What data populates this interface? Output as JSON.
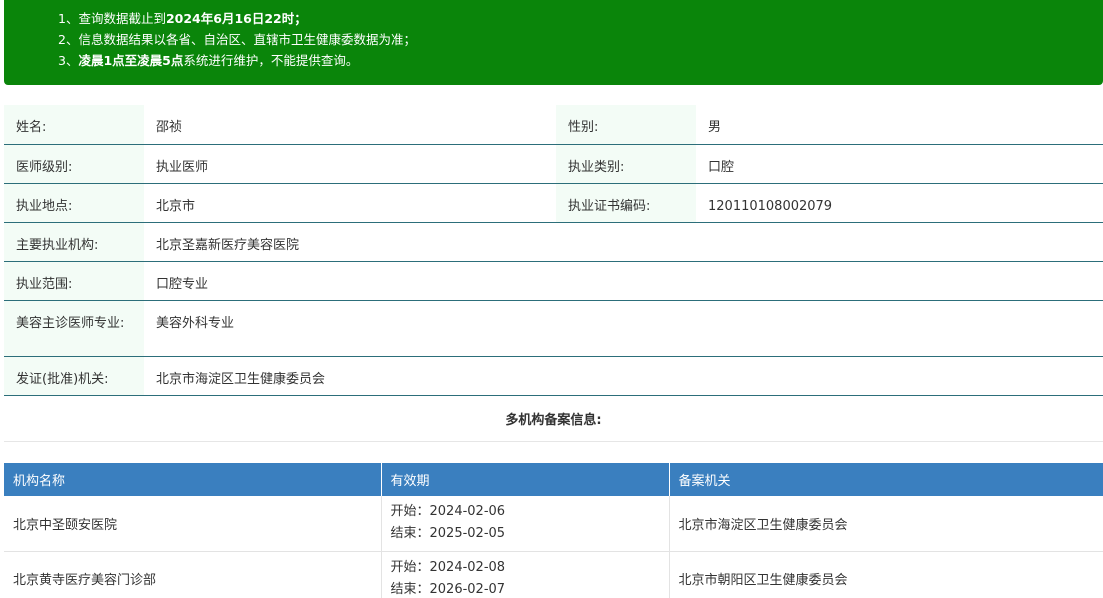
{
  "notice": {
    "line1_prefix": "1、查询数据截止到",
    "line1_bold": "2024年6月16日22时；",
    "line2": "2、信息数据结果以各省、自治区、直辖市卫生健康委数据为准；",
    "line3_prefix": "3、",
    "line3_bold": "凌晨1点至凌晨5点",
    "line3_suffix": "系统进行维护，不能提供查询。"
  },
  "info": {
    "name_label": "姓名:",
    "name_value": "邵祯",
    "gender_label": "性别:",
    "gender_value": "男",
    "level_label": "医师级别:",
    "level_value": "执业医师",
    "category_label": "执业类别:",
    "category_value": "口腔",
    "location_label": "执业地点:",
    "location_value": "北京市",
    "cert_label": "执业证书编码:",
    "cert_value": "120110108002079",
    "institution_label": "主要执业机构:",
    "institution_value": "北京圣嘉新医疗美容医院",
    "scope_label": "执业范围:",
    "scope_value": "口腔专业",
    "cosmetic_label": "美容主诊医师专业:",
    "cosmetic_value": "美容外科专业",
    "issuer_label": "发证(批准)机关:",
    "issuer_value": "北京市海淀区卫生健康委员会"
  },
  "multi": {
    "title": "多机构备案信息:",
    "headers": [
      "机构名称",
      "有效期",
      "备案机关"
    ],
    "rows": [
      {
        "name": "北京中圣颐安医院",
        "start": "开始：2024-02-06",
        "end": "结束：2025-02-05",
        "authority": "北京市海淀区卫生健康委员会"
      },
      {
        "name": "北京黄寺医疗美容门诊部",
        "start": "开始：2024-02-08",
        "end": "结束：2026-02-07",
        "authority": "北京市朝阳区卫生健康委员会"
      }
    ]
  },
  "colors": {
    "notice_bg": "#0a850a",
    "label_bg": "#f3fcf6",
    "row_border": "#2c6e7a",
    "table_header_bg": "#3a7fbf"
  }
}
